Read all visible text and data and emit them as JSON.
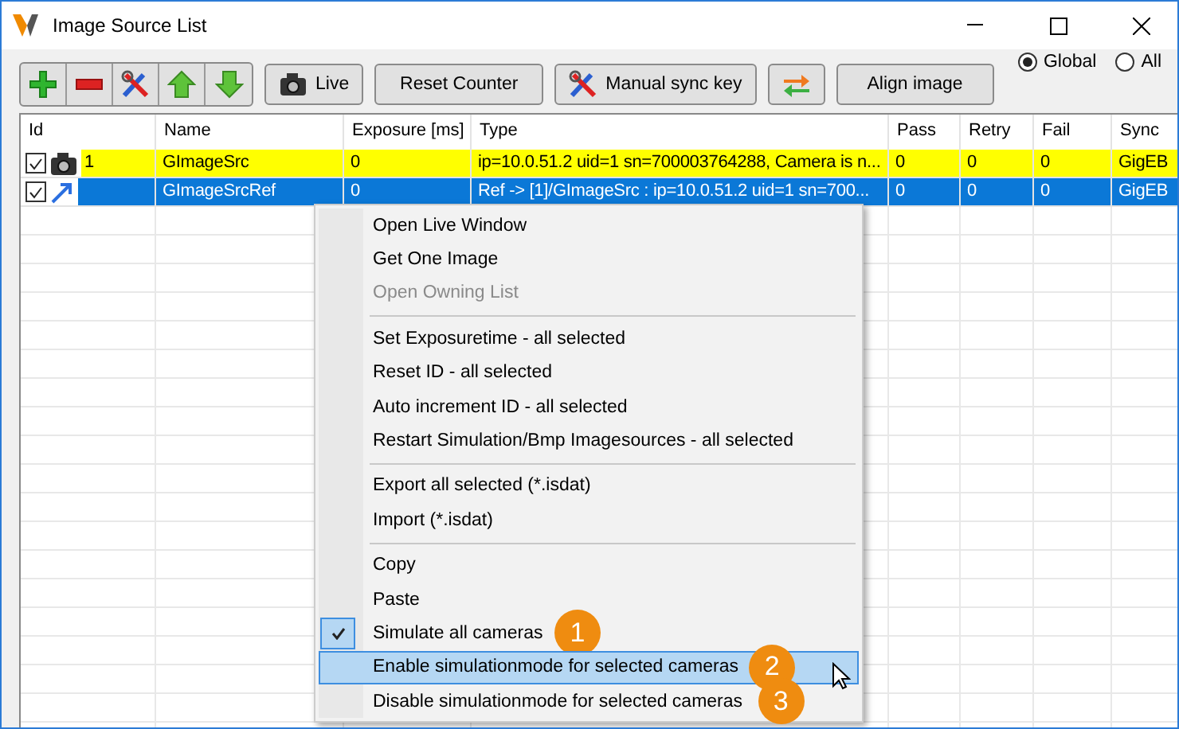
{
  "window": {
    "title": "Image Source List"
  },
  "toolbar": {
    "icon_buttons": [
      {
        "kind": "plus"
      },
      {
        "kind": "minus"
      },
      {
        "kind": "tools"
      },
      {
        "kind": "up"
      },
      {
        "kind": "down"
      }
    ],
    "buttons": [
      {
        "kind": "camera",
        "label": "Live"
      },
      {
        "kind": "text",
        "label": "Reset Counter"
      },
      {
        "kind": "tools",
        "label": "Manual sync key"
      },
      {
        "kind": "swap"
      },
      {
        "kind": "text",
        "label": "Align image"
      }
    ]
  },
  "scope": [
    {
      "label": "Global",
      "selected": true
    },
    {
      "label": "All",
      "selected": false
    }
  ],
  "table": {
    "columns": [
      "Id",
      "Name",
      "Exposure [ms]",
      "Type",
      "Pass",
      "Retry",
      "Fail",
      "Sync"
    ],
    "rows": [
      {
        "checked": true,
        "kind": "camera",
        "highlighted": true,
        "selected": false,
        "cells": [
          "1",
          "GImageSrc",
          "0",
          "ip=10.0.51.2 uid=1 sn=700003764288, Camera is n...",
          "0",
          "0",
          "0",
          "GigEB"
        ]
      },
      {
        "checked": true,
        "kind": "link",
        "highlighted": false,
        "selected": true,
        "cells": [
          "",
          "GImageSrcRef",
          "0",
          "Ref -> [1]/GImageSrc : ip=10.0.51.2 uid=1 sn=700...",
          "0",
          "0",
          "0",
          "GigEB"
        ]
      }
    ]
  },
  "context_menu": [
    [
      {
        "label": "Open Live Window",
        "disabled": false,
        "checked": false,
        "hovered": false
      },
      {
        "label": "Get One Image",
        "disabled": false,
        "checked": false,
        "hovered": false
      },
      {
        "label": "Open Owning List",
        "disabled": true,
        "checked": false,
        "hovered": false
      }
    ],
    [
      {
        "label": "Set Exposuretime - all selected",
        "disabled": false,
        "checked": false,
        "hovered": false
      },
      {
        "label": "Reset ID - all selected",
        "disabled": false,
        "checked": false,
        "hovered": false
      },
      {
        "label": "Auto increment ID - all selected",
        "disabled": false,
        "checked": false,
        "hovered": false
      },
      {
        "label": "Restart Simulation/Bmp Imagesources - all selected",
        "disabled": false,
        "checked": false,
        "hovered": false
      }
    ],
    [
      {
        "label": "Export all selected (*.isdat)",
        "disabled": false,
        "checked": false,
        "hovered": false
      },
      {
        "label": "Import (*.isdat)",
        "disabled": false,
        "checked": false,
        "hovered": false
      }
    ],
    [
      {
        "label": "Copy",
        "disabled": false,
        "checked": false,
        "hovered": false
      },
      {
        "label": "Paste",
        "disabled": false,
        "checked": false,
        "hovered": false
      },
      {
        "label": "Simulate all cameras",
        "disabled": false,
        "checked": true,
        "hovered": false,
        "callout": "1"
      },
      {
        "label": "Enable simulationmode for selected cameras",
        "disabled": false,
        "checked": false,
        "hovered": true,
        "callout": "2"
      },
      {
        "label": "Disable simulationmode for selected cameras",
        "disabled": false,
        "checked": false,
        "hovered": false,
        "callout": "3"
      }
    ]
  ]
}
